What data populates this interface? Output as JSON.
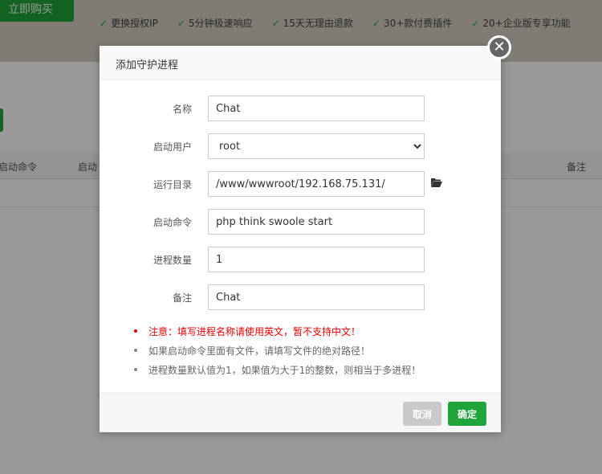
{
  "background": {
    "buy_button": "立即购买",
    "features": [
      "更换授权IP",
      "5分钟极速响应",
      "15天无理由退款",
      "30+款付费插件",
      "20+企业版专享功能"
    ],
    "table_headers": [
      "启动命令",
      "启动",
      "备注"
    ]
  },
  "dialog": {
    "title": "添加守护进程",
    "close_icon": "close-circle-icon",
    "fields": [
      {
        "label": "名称",
        "value": "Chat"
      },
      {
        "label": "启动用户",
        "value": "root",
        "type": "select"
      },
      {
        "label": "运行目录",
        "value": "/www/wwwroot/192.168.75.131/"
      },
      {
        "label": "启动命令",
        "value": "php think swoole start"
      },
      {
        "label": "进程数量",
        "value": "1"
      },
      {
        "label": "备注",
        "value": "Chat"
      }
    ],
    "notes": [
      "注意：填写进程名称请使用英文，暂不支持中文！",
      "如果启动命令里面有文件，请填写文件的绝对路径！",
      "进程数量默认值为1，如果值为大于1的整数，则相当于多进程！"
    ],
    "cancel": "取消",
    "confirm": "确定"
  },
  "colors": {
    "accent": "#20a53a",
    "warning": "#ee0000"
  }
}
